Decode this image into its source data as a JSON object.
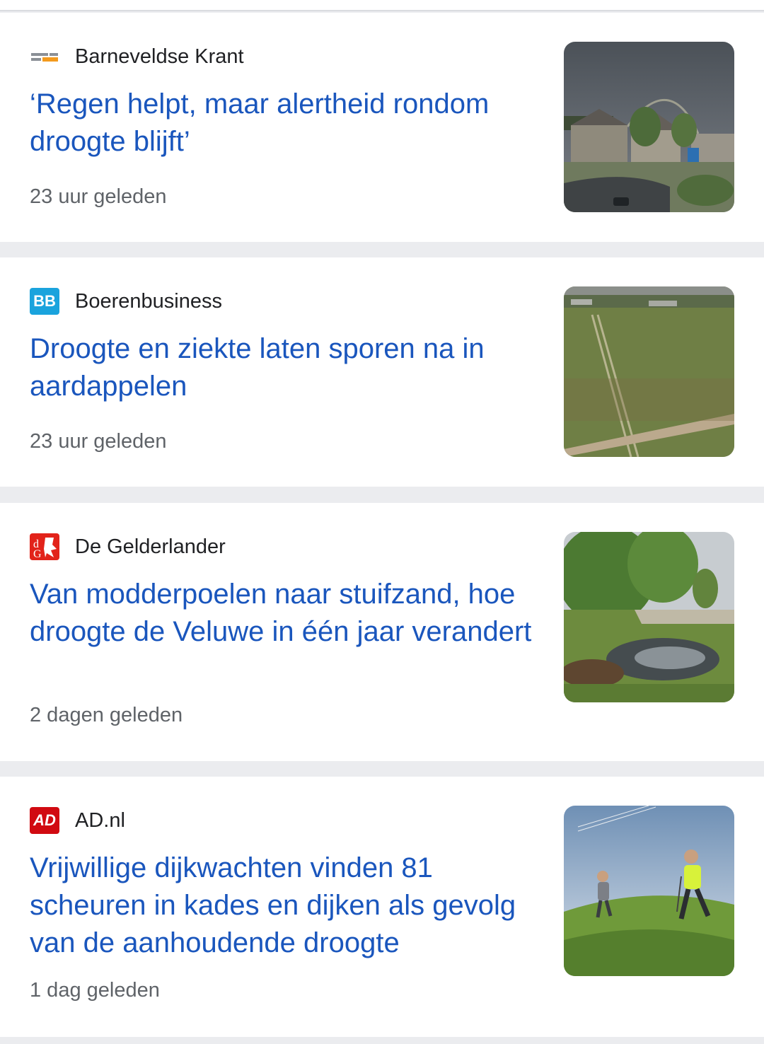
{
  "articles": [
    {
      "source": "Barneveldse Krant",
      "logo_icon": "barneveldse-krant-logo",
      "headline": "‘Regen helpt, maar alertheid rondom droogte blijft’",
      "time": "23 uur geleden",
      "thumbnail": "village-rainbow-photo"
    },
    {
      "source": "Boerenbusiness",
      "logo_icon": "boerenbusiness-logo",
      "logo_text": "BB",
      "logo_color": "#1aa3dd",
      "headline": "Droogte en ziekte laten sporen na in aardappelen",
      "time": "23 uur geleden",
      "thumbnail": "potato-field-photo"
    },
    {
      "source": "De Gelderlander",
      "logo_icon": "de-gelderlander-logo",
      "logo_color": "#e2231a",
      "headline": "Van modderpoelen naar stuifzand, hoe droogte de Veluwe in één jaar verandert",
      "time": "2 dagen geleden",
      "thumbnail": "veluwe-pond-photo"
    },
    {
      "source": "AD.nl",
      "logo_icon": "ad-logo",
      "logo_text": "AD",
      "logo_color": "#d10a11",
      "headline": "Vrijwillige dijkwachten vinden 81 scheuren in kades en dijken als gevolg van de aanhoudende droogte",
      "time": "1 dag geleden",
      "thumbnail": "dike-walkers-photo"
    }
  ],
  "colors": {
    "headline": "#1a56bd",
    "meta": "#5f6368",
    "divider": "#ebecef"
  }
}
